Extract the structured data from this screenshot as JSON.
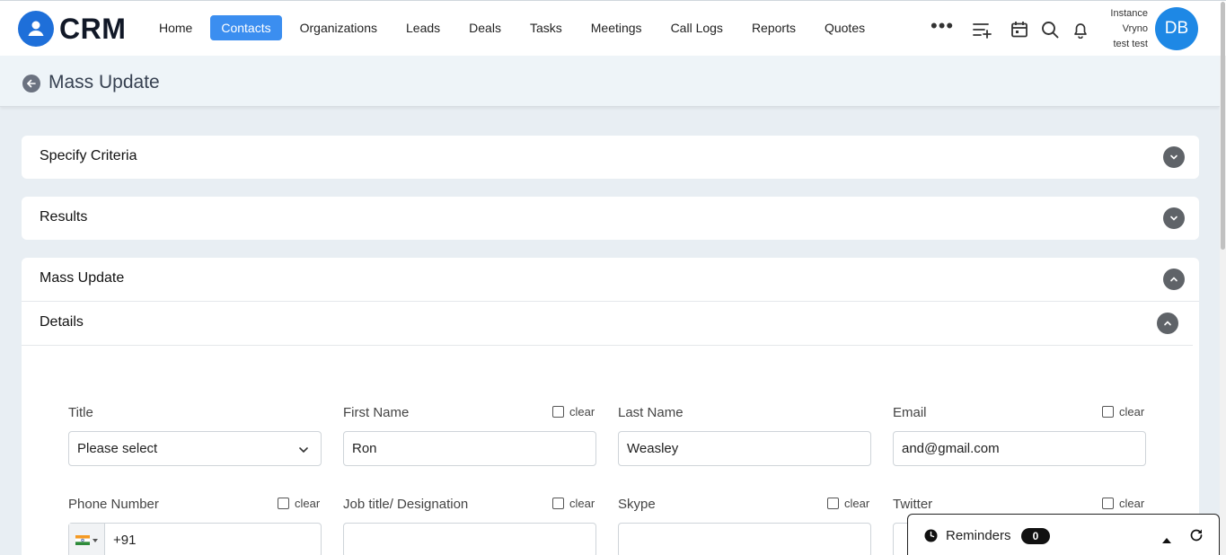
{
  "app": {
    "logo_text": "CRM"
  },
  "nav": {
    "items": [
      {
        "label": "Home",
        "active": false
      },
      {
        "label": "Contacts",
        "active": true
      },
      {
        "label": "Organizations",
        "active": false
      },
      {
        "label": "Leads",
        "active": false
      },
      {
        "label": "Deals",
        "active": false
      },
      {
        "label": "Tasks",
        "active": false
      },
      {
        "label": "Meetings",
        "active": false
      },
      {
        "label": "Call Logs",
        "active": false
      },
      {
        "label": "Reports",
        "active": false
      },
      {
        "label": "Quotes",
        "active": false
      }
    ],
    "more_label": "•••"
  },
  "user": {
    "line1": "Instance",
    "line2": "Vryno",
    "line3": "test test",
    "initials": "DB"
  },
  "colors": {
    "accent": "#3b8ef0",
    "avatar": "#1e88e5",
    "logo": "#1e6fd9"
  },
  "header": {
    "title": "Mass Update"
  },
  "sections": {
    "criteria": "Specify Criteria",
    "results": "Results",
    "mass_update": "Mass Update",
    "details": "Details"
  },
  "form": {
    "clear_label": "clear",
    "title": {
      "label": "Title",
      "value": "Please select"
    },
    "first_name": {
      "label": "First Name",
      "value": "Ron"
    },
    "last_name": {
      "label": "Last Name",
      "value": "Weasley"
    },
    "email": {
      "label": "Email",
      "value": "and@gmail.com"
    },
    "phone": {
      "label": "Phone Number",
      "value": "+91"
    },
    "job_title": {
      "label": "Job title/ Designation",
      "value": ""
    },
    "skype": {
      "label": "Skype",
      "value": ""
    },
    "twitter": {
      "label": "Twitter",
      "value": ""
    }
  },
  "reminders": {
    "label": "Reminders",
    "count": "0"
  }
}
